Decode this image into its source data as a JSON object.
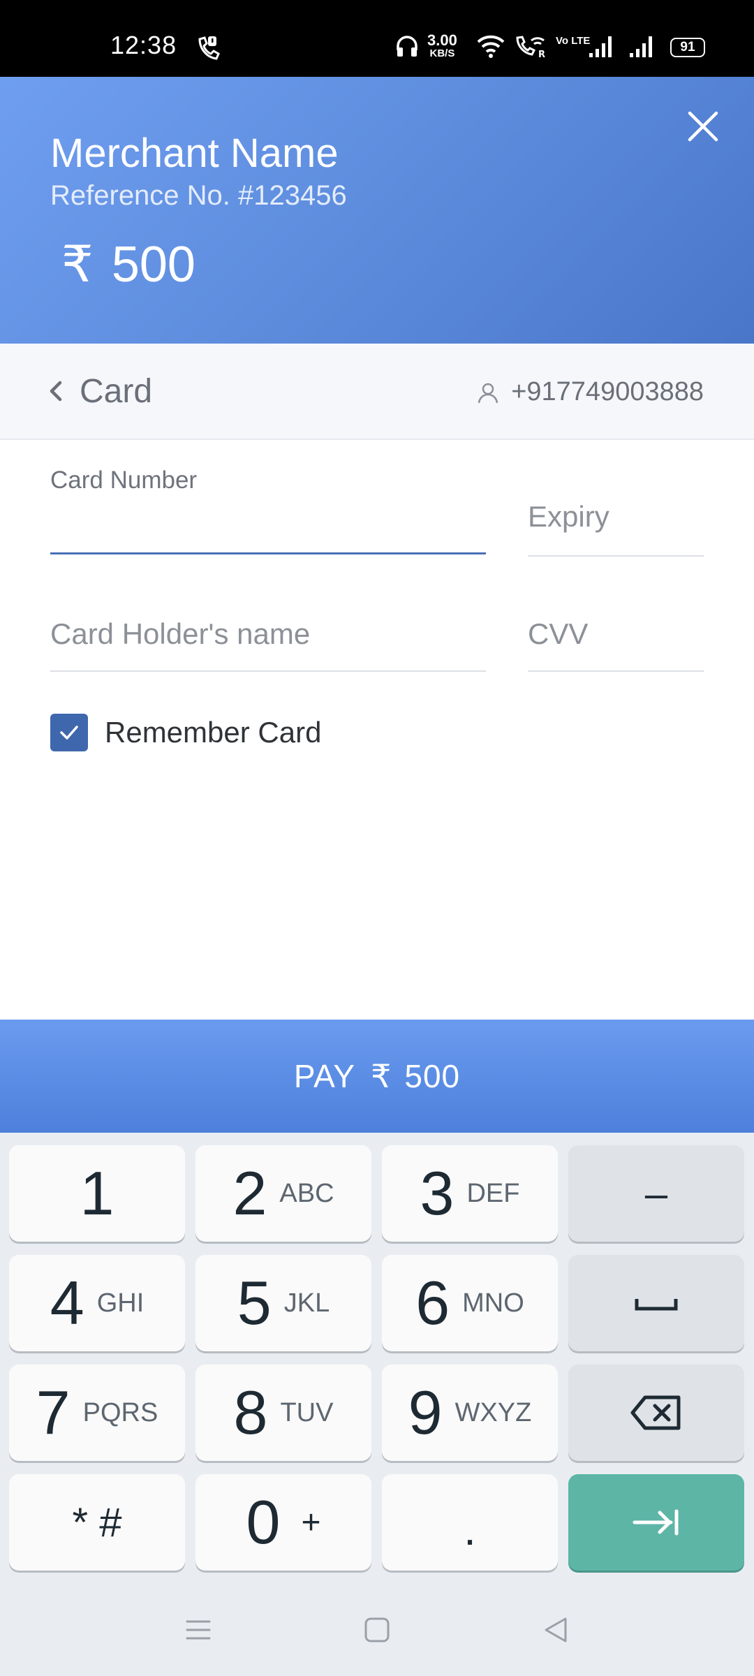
{
  "status_bar": {
    "time": "12:38",
    "net_speed": "3.00",
    "net_speed_unit": "KB/S",
    "volte": "Vo LTE",
    "battery": "91"
  },
  "header": {
    "merchant_name": "Merchant Name",
    "reference": "Reference No. #123456",
    "currency_symbol": "₹",
    "amount": "500",
    "close_icon": "close-icon"
  },
  "method_bar": {
    "title": "Card",
    "phone": "+917749003888",
    "back_icon": "chevron-left-icon",
    "user_icon": "user-icon"
  },
  "form": {
    "card_number_label": "Card Number",
    "expiry_placeholder": "Expiry",
    "holder_placeholder": "Card Holder's name",
    "cvv_placeholder": "CVV",
    "remember_label": "Remember Card",
    "remember_checked": true
  },
  "pay_button": {
    "label": "PAY",
    "currency_symbol": "₹",
    "amount": "500"
  },
  "keypad": {
    "keys": [
      {
        "main": "1",
        "sub": ""
      },
      {
        "main": "2",
        "sub": "ABC"
      },
      {
        "main": "3",
        "sub": "DEF"
      },
      {
        "main": "–",
        "sub": ""
      },
      {
        "main": "4",
        "sub": "GHI"
      },
      {
        "main": "5",
        "sub": "JKL"
      },
      {
        "main": "6",
        "sub": "MNO"
      },
      {
        "main": "",
        "sub": ""
      },
      {
        "main": "7",
        "sub": "PQRS"
      },
      {
        "main": "8",
        "sub": "TUV"
      },
      {
        "main": "9",
        "sub": "WXYZ"
      },
      {
        "main": "",
        "sub": ""
      },
      {
        "main": "* #",
        "sub": ""
      },
      {
        "main": "0",
        "sub": "+"
      },
      {
        "main": ".",
        "sub": ""
      },
      {
        "main": "",
        "sub": ""
      }
    ]
  },
  "colors": {
    "header_blue": "#5f8edf",
    "pay_blue": "#5b8ce6",
    "checkbox_blue": "#3f67ad",
    "enter_teal": "#5db5a6"
  }
}
